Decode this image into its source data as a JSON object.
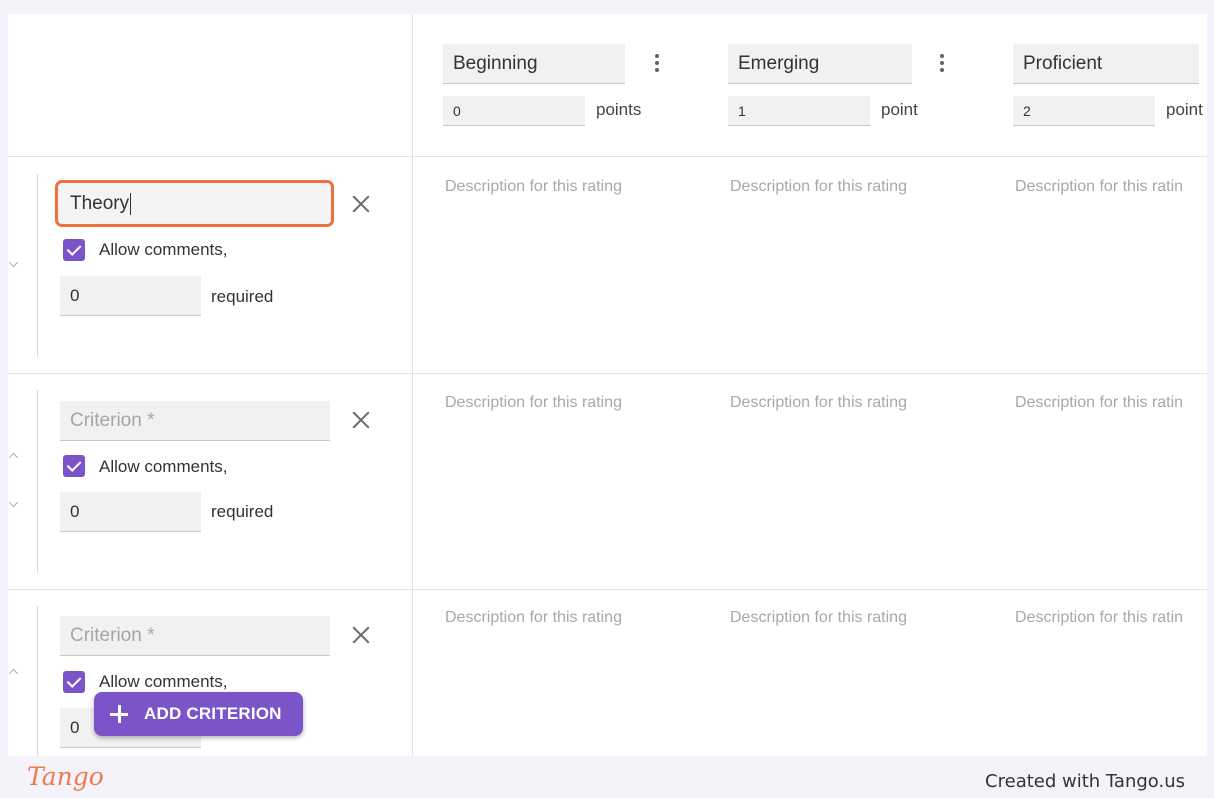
{
  "levels": [
    {
      "title": "Beginning",
      "points": "0",
      "unit": "points",
      "description_placeholder": "Description for this rating"
    },
    {
      "title": "Emerging",
      "points": "1",
      "unit": "point",
      "description_placeholder": "Description for this rating"
    },
    {
      "title": "Proficient",
      "points": "2",
      "unit": "point",
      "description_placeholder": "Description for this ratin"
    }
  ],
  "criteria": [
    {
      "value": "Theory",
      "placeholder": "Criterion *",
      "allow_comments_label": "Allow comments,",
      "allow_comments_checked": true,
      "required_count": "0",
      "required_label": "required"
    },
    {
      "value": "",
      "placeholder": "Criterion *",
      "allow_comments_label": "Allow comments,",
      "allow_comments_checked": true,
      "required_count": "0",
      "required_label": "required"
    },
    {
      "value": "",
      "placeholder": "Criterion *",
      "allow_comments_label": "Allow comments,",
      "allow_comments_checked": true,
      "required_count": "0",
      "required_label": ""
    }
  ],
  "add_criterion": {
    "label": "ADD CRITERION",
    "icon": "plus-icon"
  },
  "footer": {
    "logo": "Tango",
    "credit": "Created with Tango.us"
  },
  "colors": {
    "accent": "#7b54c9",
    "focus_outline": "#f0703d",
    "tango_brand": "#f07a4f"
  }
}
